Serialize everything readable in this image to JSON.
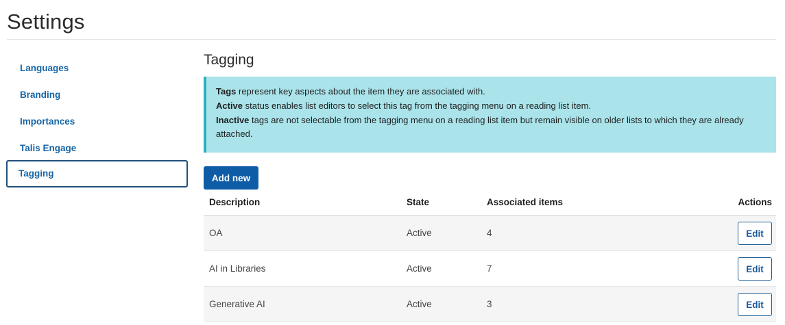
{
  "page": {
    "title": "Settings"
  },
  "sidebar": {
    "items": [
      {
        "label": "Languages",
        "active": false
      },
      {
        "label": "Branding",
        "active": false
      },
      {
        "label": "Importances",
        "active": false
      },
      {
        "label": "Talis Engage",
        "active": false
      },
      {
        "label": "Tagging",
        "active": true
      }
    ]
  },
  "main": {
    "section_title": "Tagging",
    "info": {
      "line1_bold": "Tags",
      "line1_rest": " represent key aspects about the item they are associated with.",
      "line2_bold": "Active",
      "line2_rest": " status enables list editors to select this tag from the tagging menu on a reading list item.",
      "line3_bold": "Inactive",
      "line3_rest": " tags are not selectable from the tagging menu on a reading list item but remain visible on older lists to which they are already attached."
    },
    "add_button_label": "Add new",
    "table": {
      "headers": {
        "description": "Description",
        "state": "State",
        "associated": "Associated items",
        "actions": "Actions"
      },
      "rows": [
        {
          "description": "OA",
          "state": "Active",
          "associated": "4",
          "action": "Edit"
        },
        {
          "description": "AI in Libraries",
          "state": "Active",
          "associated": "7",
          "action": "Edit"
        },
        {
          "description": "Generative AI",
          "state": "Active",
          "associated": "3",
          "action": "Edit"
        }
      ]
    }
  },
  "colors": {
    "link": "#1565a6",
    "primary_button": "#0f5ca6",
    "info_background": "#aae3ea",
    "info_border": "#2ab0be"
  }
}
